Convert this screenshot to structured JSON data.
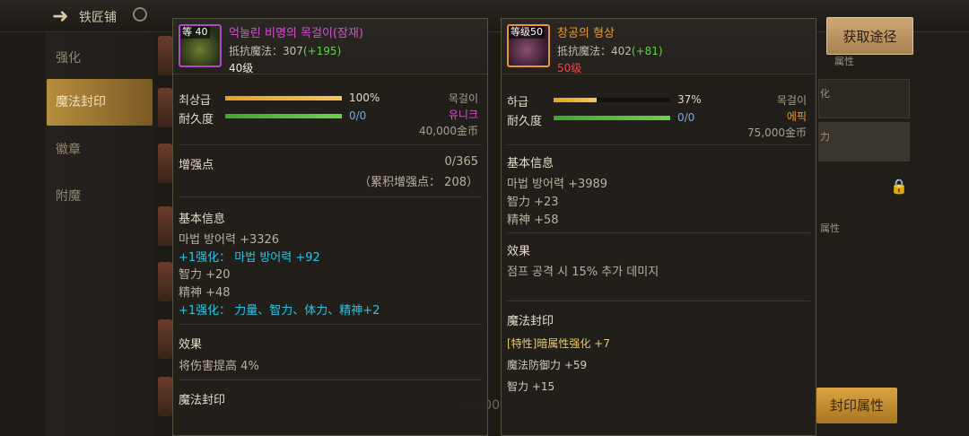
{
  "background": {
    "title": "铁匠铺",
    "sidebar": [
      "强化",
      "魔法封印",
      "徽章",
      "附魔"
    ],
    "right_labels": [
      "属性",
      "化",
      "力",
      "属性"
    ],
    "seal_button": "封印属性"
  },
  "acquire_button": "获取途径",
  "left_item": {
    "level_tag": "40",
    "level_tag_prefix": "等",
    "name": "억눌린 비명의 목걸이(잠재)",
    "resist_label": "抵抗魔法：",
    "resist_value": "307",
    "resist_bonus": "(+195)",
    "level_text": "40级",
    "grade_label": "최상급",
    "grade_value": "100%",
    "grade_pct": 100,
    "durability_label": "耐久度",
    "durability_value": "0/0",
    "type": "목걸이",
    "rarity": "유니크",
    "price": "40,000金币",
    "enhance_title": "增强点",
    "enhance_value": "0/365",
    "accum_enhance": "（累积增强点： 208）",
    "basic_title": "基本信息",
    "basic_lines": [
      {
        "text": "마법 방어력 +3326",
        "style": ""
      },
      {
        "text": "+1强化：  마법 방어력 +92",
        "style": "cyan"
      },
      {
        "text": "智力 +20",
        "style": ""
      },
      {
        "text": "精神 +48",
        "style": ""
      },
      {
        "text": "+1强化：  力量、智力、体力、精神+2",
        "style": "cyan"
      }
    ],
    "effect_title": "效果",
    "effect_text": "将伤害提高 4%",
    "seal_title": "魔法封印"
  },
  "right_item": {
    "level_tag": "等级50",
    "name": "창공의 형상",
    "resist_label": "抵抗魔法：",
    "resist_value": "402",
    "resist_bonus": "(+81)",
    "level_text": "50级",
    "grade_label": "하급",
    "grade_value": "37%",
    "grade_pct": 37,
    "durability_label": "耐久度",
    "durability_value": "0/0",
    "type": "목걸이",
    "rarity": "에픽",
    "price": "75,000金币",
    "basic_title": "基本信息",
    "basic_lines": [
      "마법 방어력 +3989",
      "智力 +23",
      "精神 +58"
    ],
    "effect_title": "效果",
    "effect_text": "점프 공격 시 15% 추가 데미지",
    "seal_title": "魔法封印",
    "seal_lines": [
      {
        "text": "[特性]暗属性强化 +7",
        "style": "gold"
      },
      {
        "text": "魔法防御力 +59",
        "style": "small"
      },
      {
        "text": "智力 +15",
        "style": "small"
      }
    ]
  },
  "colors": {
    "unique": "#d64fd0",
    "epic": "#e89a2e",
    "grade_bar_gold": "#e8a020",
    "durability_bar_green": "#56c23a",
    "red_level": "#e84a4a"
  }
}
